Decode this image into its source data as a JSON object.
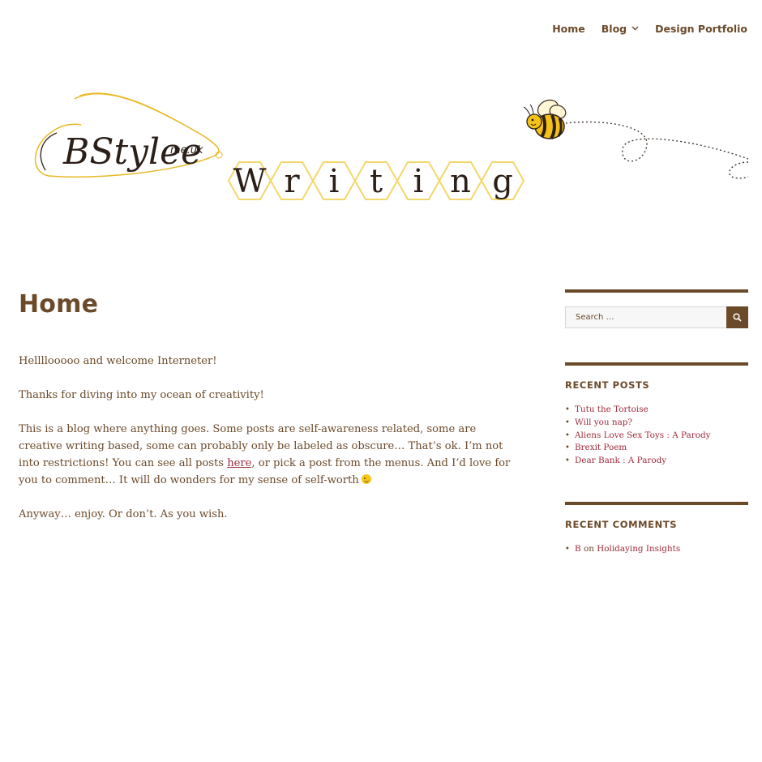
{
  "nav": {
    "items": [
      {
        "label": "Home"
      },
      {
        "label": "Blog",
        "has_submenu": true
      },
      {
        "label": "Design Portfolio"
      }
    ],
    "submenu_icon": "chevron-down-icon"
  },
  "banner": {
    "logo_text": "BStylee",
    "logo_suffix": "me.uk",
    "word_letters": [
      "W",
      "r",
      "i",
      "t",
      "i",
      "n",
      "g"
    ],
    "bee_icon": "bee-icon"
  },
  "main": {
    "title": "Home",
    "p1": "Hellllooooo and welcome Interneter!",
    "p2": "Thanks for diving into my ocean of creativity!",
    "p3_before": "This is a blog where anything goes. Some posts are self-awareness related, some are creative writing based, some can probably only be labeled as obscure… That’s ok. I’m not into restrictions! You can see all posts ",
    "p3_link": "here",
    "p3_after": ", or pick a post from the menus. And I’d love for you to comment… It will do wonders for my sense of self-worth",
    "p3_emoji": "winking-face-emoji",
    "p4": "Anyway… enjoy. Or don’t. As you wish."
  },
  "sidebar": {
    "search": {
      "placeholder": "Search …",
      "icon": "search-icon"
    },
    "recent_posts": {
      "title": "RECENT POSTS",
      "items": [
        "Tutu the Tortoise",
        "Will you nap?",
        "Aliens Love Sex Toys : A Parody",
        "Brexit Poem",
        "Dear Bank : A Parody"
      ]
    },
    "recent_comments": {
      "title": "RECENT COMMENTS",
      "items": [
        {
          "author": "B",
          "joiner": "on",
          "post": "Holidaying Insights"
        }
      ]
    }
  },
  "colors": {
    "text": "#6b4a2a",
    "link": "#a02b3c",
    "honeycomb": "#f3d76b"
  }
}
